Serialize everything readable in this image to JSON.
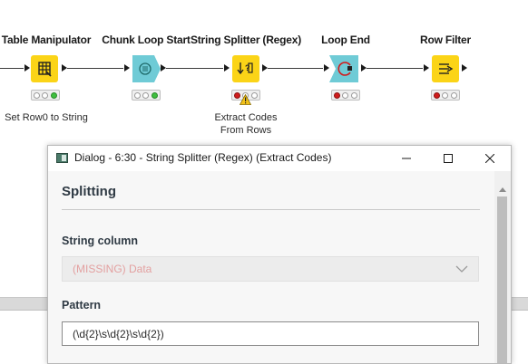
{
  "workflow": {
    "nodes": [
      {
        "title": "Table Manipulator",
        "label": "Set Row0 to String",
        "status": [
          "off",
          "off",
          "green"
        ],
        "color": "yellow"
      },
      {
        "title": "Chunk Loop Start",
        "label": "",
        "status": [
          "off",
          "off",
          "green"
        ],
        "color": "teal"
      },
      {
        "title": "String Splitter (Regex)",
        "label_line1": "Extract Codes",
        "label_line2": "From Rows",
        "status": [
          "red",
          "off",
          "off"
        ],
        "color": "yellow",
        "warning": true
      },
      {
        "title": "Loop End",
        "label": "",
        "status": [
          "red",
          "off",
          "off"
        ],
        "color": "teal"
      },
      {
        "title": "Row Filter",
        "label": "",
        "status": [
          "red",
          "off",
          "off"
        ],
        "color": "yellow"
      }
    ]
  },
  "dialog": {
    "title": "Dialog - 6:30 - String Splitter (Regex) (Extract Codes)",
    "section_title": "Splitting",
    "string_column_label": "String column",
    "string_column_value": "(MISSING) Data",
    "pattern_label": "Pattern",
    "pattern_value": "(\\d{2}\\s\\d{2}\\s\\d{2})"
  },
  "icons": {
    "dialog_icon": "knime-dialog-icon",
    "minimize": "minimize-icon",
    "maximize": "maximize-icon",
    "close": "close-icon",
    "chevron": "chevron-down-icon",
    "warning": "warning-icon"
  },
  "colors": {
    "node_yellow": "#fbd417",
    "node_teal": "#6fcbd6",
    "status_green": "#3fbf3f",
    "status_red": "#d11c1c",
    "missing_text": "#e3a0a0"
  }
}
